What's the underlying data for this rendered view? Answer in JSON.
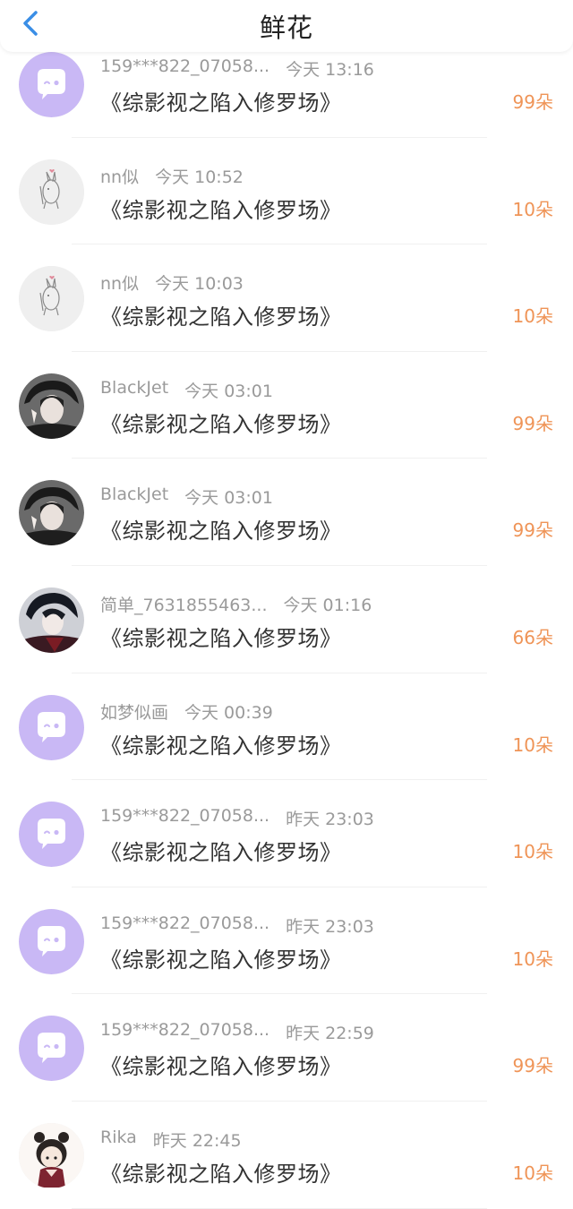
{
  "header": {
    "title": "鲜花",
    "back_icon": "chevron-left-icon",
    "accent": "#3a8ee6"
  },
  "colors": {
    "flowers": "#ef9457",
    "meta": "#9a9a9a",
    "default_avatar_bg": "#c9b8f5"
  },
  "entries": [
    {
      "user": "159***822_07058...",
      "time": "今天 13:16",
      "book": "《综影视之陷入修罗场》",
      "flowers": "99朵",
      "avatar": "default"
    },
    {
      "user": "nn似",
      "time": "今天 10:52",
      "book": "《综影视之陷入修罗场》",
      "flowers": "10朵",
      "avatar": "rabbit"
    },
    {
      "user": "nn似",
      "time": "今天 10:03",
      "book": "《综影视之陷入修罗场》",
      "flowers": "10朵",
      "avatar": "rabbit"
    },
    {
      "user": "BlackJet",
      "time": "今天 03:01",
      "book": "《综影视之陷入修罗场》",
      "flowers": "99朵",
      "avatar": "girl-dark"
    },
    {
      "user": "BlackJet",
      "time": "今天 03:01",
      "book": "《综影视之陷入修罗场》",
      "flowers": "99朵",
      "avatar": "girl-dark"
    },
    {
      "user": "简单_7631855463...",
      "time": "今天 01:16",
      "book": "《综影视之陷入修罗场》",
      "flowers": "66朵",
      "avatar": "anime-boy"
    },
    {
      "user": "如梦似画",
      "time": "今天 00:39",
      "book": "《综影视之陷入修罗场》",
      "flowers": "10朵",
      "avatar": "default"
    },
    {
      "user": "159***822_07058...",
      "time": "昨天 23:03",
      "book": "《综影视之陷入修罗场》",
      "flowers": "10朵",
      "avatar": "default"
    },
    {
      "user": "159***822_07058...",
      "time": "昨天 23:03",
      "book": "《综影视之陷入修罗场》",
      "flowers": "10朵",
      "avatar": "default"
    },
    {
      "user": "159***822_07058...",
      "time": "昨天 22:59",
      "book": "《综影视之陷入修罗场》",
      "flowers": "99朵",
      "avatar": "default"
    },
    {
      "user": "Rika",
      "time": "昨天 22:45",
      "book": "《综影视之陷入修罗场》",
      "flowers": "10朵",
      "avatar": "chibi-girl"
    }
  ]
}
